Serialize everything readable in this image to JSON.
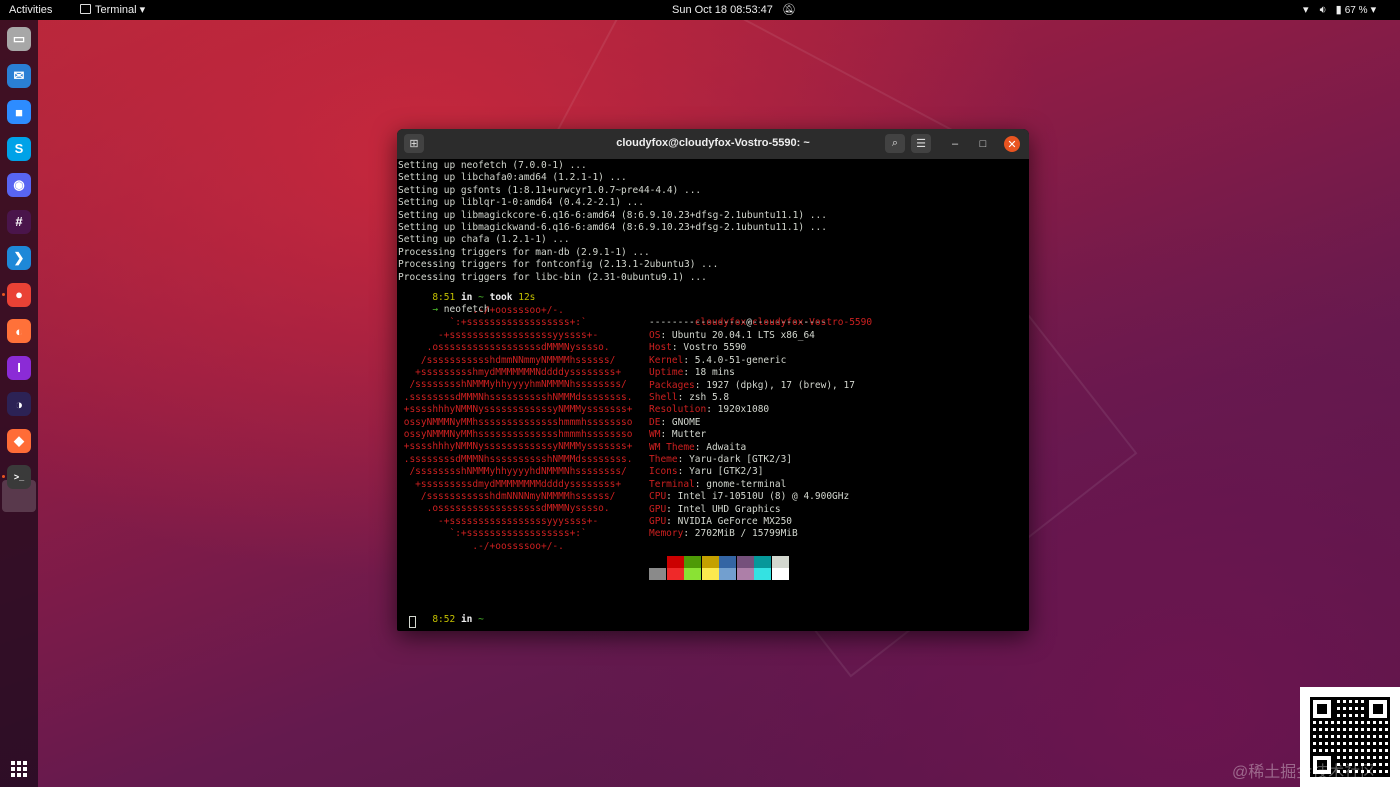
{
  "topbar": {
    "activities": "Activities",
    "app_name": "Terminal",
    "clock": "Sun Oct 18  08:53:47",
    "battery": "67 %"
  },
  "dock": {
    "apps": [
      {
        "name": "files",
        "glyph": "▭",
        "color": "#a7a7a7"
      },
      {
        "name": "thunderbird",
        "glyph": "✉",
        "color": "#2a7fd4"
      },
      {
        "name": "zoom",
        "glyph": "■",
        "color": "#2d8cff"
      },
      {
        "name": "skype",
        "glyph": "S",
        "color": "#00a2e8"
      },
      {
        "name": "discord",
        "glyph": "◉",
        "color": "#5865f2"
      },
      {
        "name": "slack",
        "glyph": "#",
        "color": "#4a154b"
      },
      {
        "name": "vscode",
        "glyph": "❯",
        "color": "#1e88d8"
      },
      {
        "name": "chrome",
        "glyph": "●",
        "color": "#e94235"
      },
      {
        "name": "firefox",
        "glyph": "◐",
        "color": "#ff7139"
      },
      {
        "name": "intellij",
        "glyph": "I",
        "color": "#8b2bd6"
      },
      {
        "name": "eclipse",
        "glyph": "◑",
        "color": "#2c2255"
      },
      {
        "name": "postman",
        "glyph": "◆",
        "color": "#ff6c37"
      },
      {
        "name": "terminal",
        "glyph": ">_",
        "color": "#3a3a3a"
      }
    ]
  },
  "terminal": {
    "title": "cloudyfox@cloudyfox-Vostro-5590: ~",
    "output_lines": [
      "Setting up neofetch (7.0.0-1) ...",
      "Setting up libchafa0:amd64 (1.2.1-1) ...",
      "Setting up gsfonts (1:8.11+urwcyr1.0.7~pre44-4.4) ...",
      "Setting up liblqr-1-0:amd64 (0.4.2-2.1) ...",
      "Setting up libmagickcore-6.q16-6:amd64 (8:6.9.10.23+dfsg-2.1ubuntu11.1) ...",
      "Setting up libmagickwand-6.q16-6:amd64 (8:6.9.10.23+dfsg-2.1ubuntu11.1) ...",
      "Setting up chafa (1.2.1-1) ...",
      "Processing triggers for man-db (2.9.1-1) ...",
      "Processing triggers for fontconfig (2.13.1-2ubuntu3) ...",
      "Processing triggers for libc-bin (2.31-0ubuntu9.1) ..."
    ],
    "prompt1": {
      "time": "8:51",
      "in": "in",
      "dir": "~",
      "took": "took",
      "duration": "12s"
    },
    "command": "neofetch",
    "prompt2": {
      "time": "8:52",
      "in": "in",
      "dir": "~"
    },
    "arrow": "→",
    "logo_lines": [
      "             .-/+oossssoo+/-.",
      "         `:+ssssssssssssssssss+:`",
      "       -+ssssssssssssssssssyyssss+-",
      "     .ossssssssssssssssssdMMMNysssso.",
      "    /ssssssssssshdmmNNmmyNMMMMhssssss/",
      "   +ssssssssshmydMMMMMMMNddddyssssssss+",
      "  /sssssssshNMMMyhhyyyyhmNMMMNhssssssss/",
      " .ssssssssdMMMNhsssssssssshNMMMdssssssss.",
      " +sssshhhyNMMNyssssssssssssyNMMMysssssss+",
      " ossyNMMMNyMMhsssssssssssssshmmmhssssssso",
      " ossyNMMMNyMMhsssssssssssssshmmmhssssssso",
      " +sssshhhyNMMNyssssssssssssyNMMMysssssss+",
      " .ssssssssdMMMNhsssssssssshNMMMdssssssss.",
      "  /sssssssshNMMMyhhyyyyhdNMMMNhssssssss/",
      "   +sssssssssdmydMMMMMMMMddddyssssssss+",
      "    /ssssssssssshdmNNNNmyNMMMMhssssss/",
      "     .ossssssssssssssssssdMMMNysssso.",
      "       -+sssssssssssssssssyyyssss+-",
      "         `:+ssssssssssssssssss+:`",
      "             .-/+oossssoo+/-."
    ],
    "neofetch": {
      "user": "cloudyfox",
      "at": "@",
      "host": "cloudyfox-Vostro-5590",
      "separator": "-------------------------------",
      "fields": [
        {
          "key": "OS",
          "value": "Ubuntu 20.04.1 LTS x86_64"
        },
        {
          "key": "Host",
          "value": "Vostro 5590"
        },
        {
          "key": "Kernel",
          "value": "5.4.0-51-generic"
        },
        {
          "key": "Uptime",
          "value": "18 mins"
        },
        {
          "key": "Packages",
          "value": "1927 (dpkg), 17 (brew), 17"
        },
        {
          "key": "Shell",
          "value": "zsh 5.8"
        },
        {
          "key": "Resolution",
          "value": "1920x1080"
        },
        {
          "key": "DE",
          "value": "GNOME"
        },
        {
          "key": "WM",
          "value": "Mutter"
        },
        {
          "key": "WM Theme",
          "value": "Adwaita"
        },
        {
          "key": "Theme",
          "value": "Yaru-dark [GTK2/3]"
        },
        {
          "key": "Icons",
          "value": "Yaru [GTK2/3]"
        },
        {
          "key": "Terminal",
          "value": "gnome-terminal"
        },
        {
          "key": "CPU",
          "value": "Intel i7-10510U (8) @ 4.900GHz"
        },
        {
          "key": "GPU",
          "value": "Intel UHD Graphics"
        },
        {
          "key": "GPU",
          "value": "NVIDIA GeForce MX250"
        },
        {
          "key": "Memory",
          "value": "2702MiB / 15799MiB"
        }
      ],
      "palette_top": [
        "#000000",
        "#cc0000",
        "#4e9a06",
        "#c4a000",
        "#3465a4",
        "#75507b",
        "#06989a",
        "#d3d7cf"
      ],
      "palette_bottom": [
        "#8a8a8a",
        "#ef2929",
        "#8ae234",
        "#fce94f",
        "#729fcf",
        "#ad7fa8",
        "#34e2e2",
        "#ffffff"
      ]
    }
  },
  "watermark": "@稀土掘金技术社区"
}
